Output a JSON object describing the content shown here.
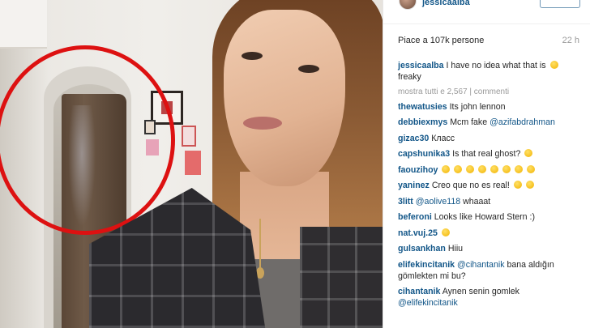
{
  "post": {
    "username": "jessicaalba",
    "likes": "Piace a 107k persone",
    "time": "22 h",
    "caption_user": "jessicaalba",
    "caption_text": "I have no idea what that is",
    "caption_text2": "freaky",
    "more_comments": "mostra tutti e 2,567 | commenti"
  },
  "comments": [
    {
      "user": "thewatusies",
      "text": "Its john lennon"
    },
    {
      "user": "debbiexmys",
      "text": "Mcm fake",
      "mention": "@azifabdrahman"
    },
    {
      "user": "gizac30",
      "text": "Класс"
    },
    {
      "user": "capshunika3",
      "text": "Is that real ghost?"
    },
    {
      "user": "faouzihoy",
      "text": ""
    },
    {
      "user": "yaninez",
      "text": "Creo que no es real!"
    },
    {
      "user": "3litt",
      "mention": "@aolive118",
      "text": "whaaat"
    },
    {
      "user": "beferoni",
      "text": "Looks like Howard Stern :)"
    },
    {
      "user": "nat.vuj.25",
      "text": ""
    },
    {
      "user": "gulsankhan",
      "text": "Hiiu"
    },
    {
      "user": "elifekincitanik",
      "mention": "@cihantanik",
      "text": "bana aldığın",
      "text2": "gömlekten mi bu?"
    },
    {
      "user": "cihantanik",
      "text": "Aynen senin gomlek",
      "mention2": "@elifekincitanik"
    }
  ],
  "icons": {
    "emoji": "emoji-icon",
    "avatar": "avatar"
  },
  "colors": {
    "username_blue": "#125688",
    "circle_red": "#dd1111"
  }
}
